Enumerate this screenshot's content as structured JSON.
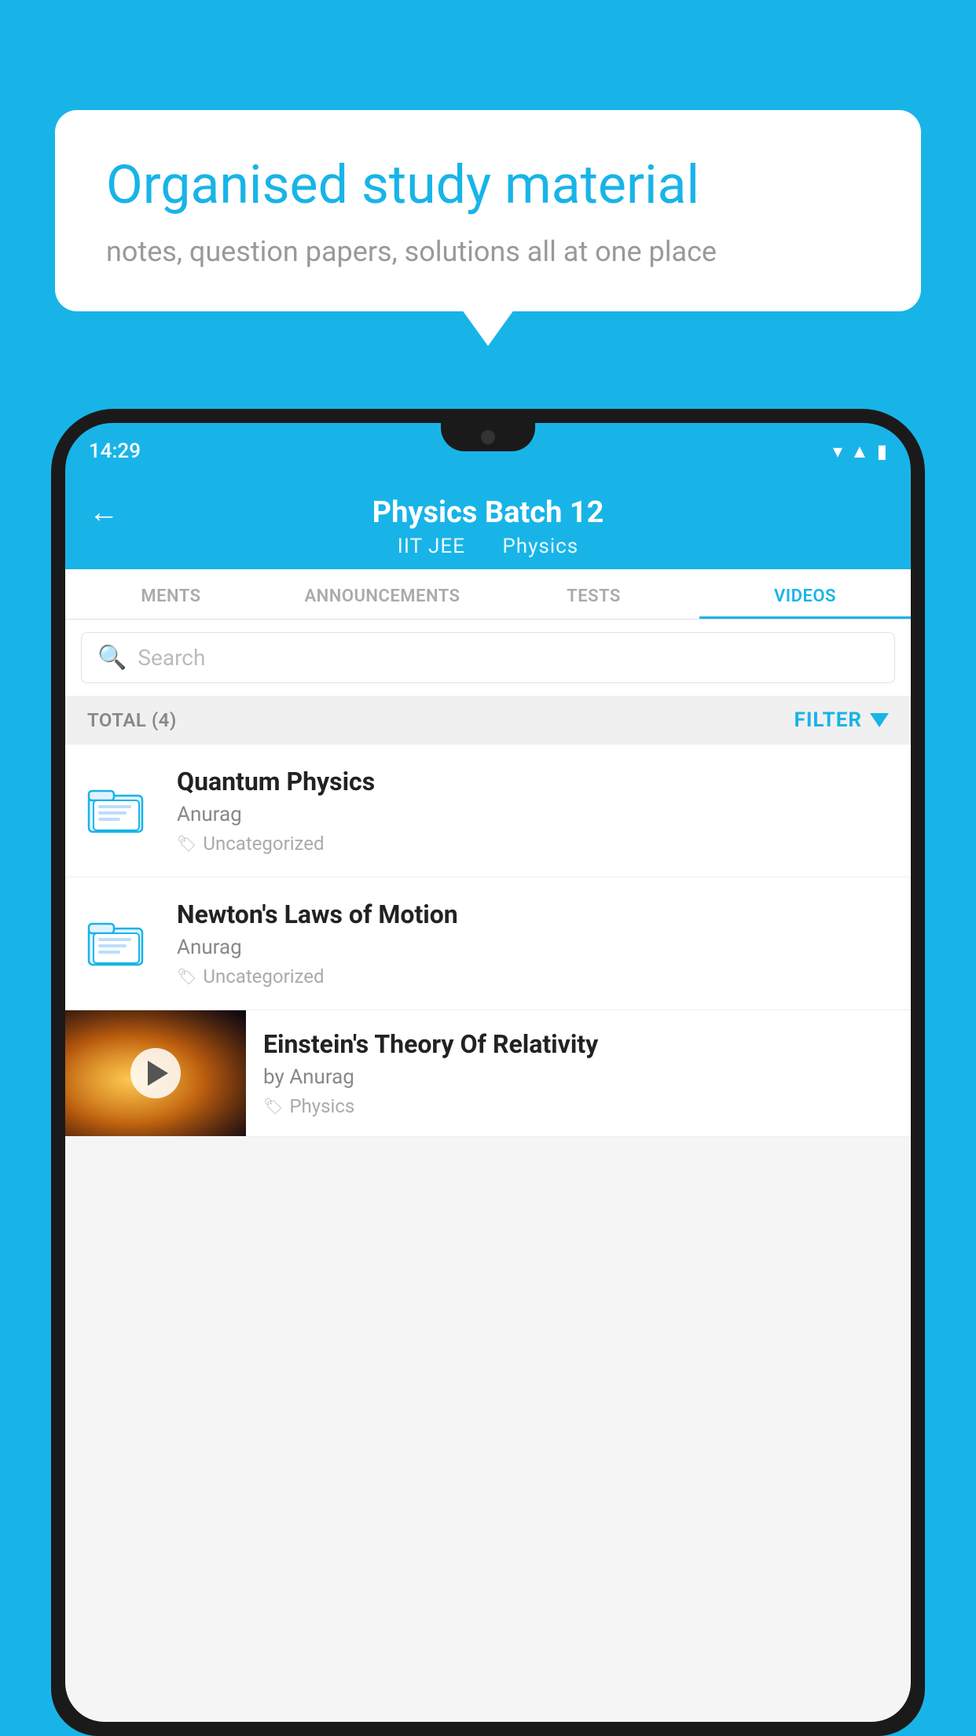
{
  "background_color": "#18b4e8",
  "speech_bubble": {
    "title": "Organised study material",
    "subtitle": "notes, question papers, solutions all at one place"
  },
  "phone": {
    "status_bar": {
      "time": "14:29"
    },
    "header": {
      "back_label": "←",
      "title": "Physics Batch 12",
      "subtitle_part1": "IIT JEE",
      "subtitle_part2": "Physics"
    },
    "tabs": [
      {
        "label": "MENTS",
        "active": false
      },
      {
        "label": "ANNOUNCEMENTS",
        "active": false
      },
      {
        "label": "TESTS",
        "active": false
      },
      {
        "label": "VIDEOS",
        "active": true
      }
    ],
    "search": {
      "placeholder": "Search"
    },
    "filter_bar": {
      "total_label": "TOTAL (4)",
      "filter_label": "FILTER"
    },
    "videos": [
      {
        "type": "folder",
        "title": "Quantum Physics",
        "author": "Anurag",
        "tag": "Uncategorized"
      },
      {
        "type": "folder",
        "title": "Newton's Laws of Motion",
        "author": "Anurag",
        "tag": "Uncategorized"
      },
      {
        "type": "thumb",
        "title": "Einstein's Theory Of Relativity",
        "author": "by Anurag",
        "tag": "Physics"
      }
    ]
  }
}
